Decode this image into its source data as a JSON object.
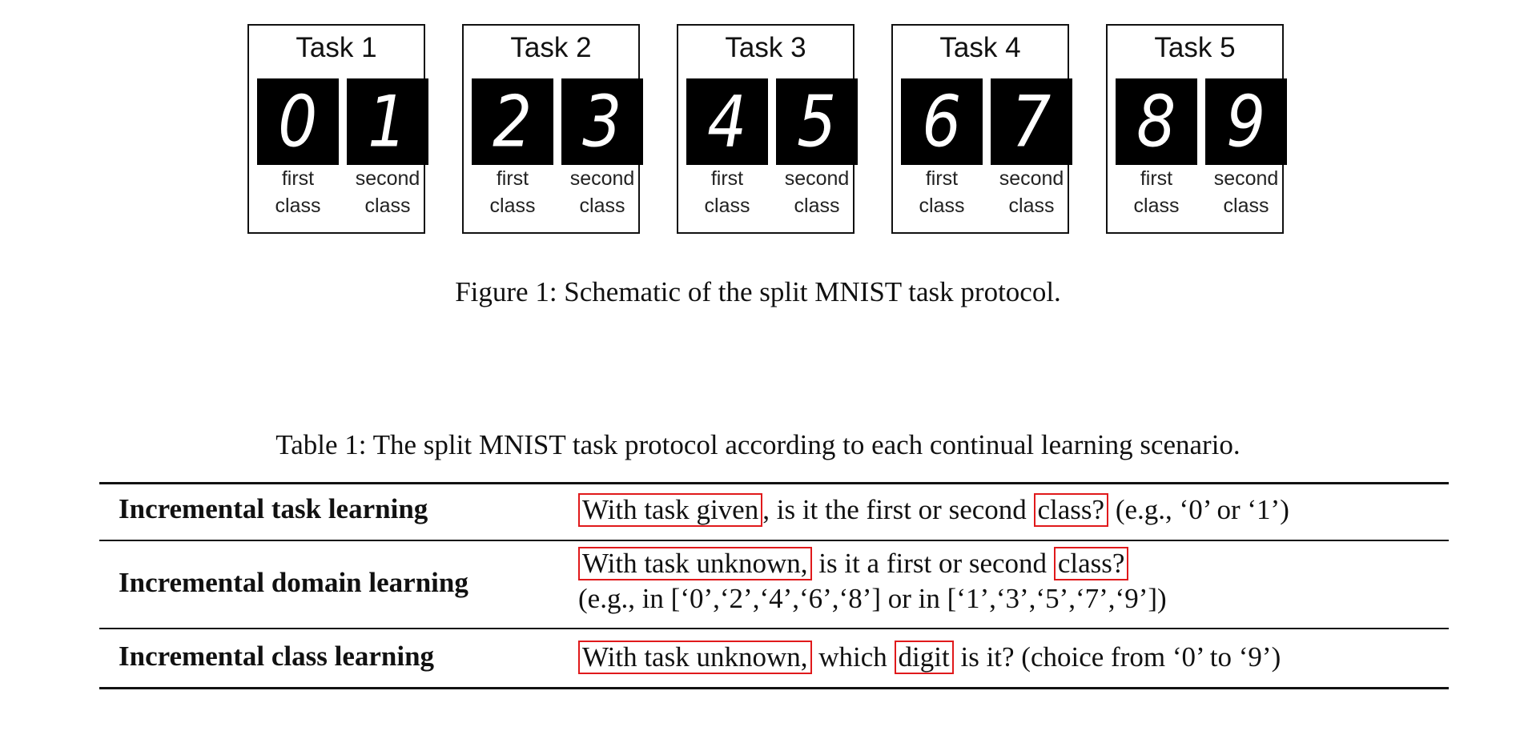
{
  "figure": {
    "tasks": [
      {
        "title": "Task 1",
        "first_digit": "0",
        "second_digit": "1",
        "first_label": "first\nclass",
        "second_label": "second\nclass"
      },
      {
        "title": "Task 2",
        "first_digit": "2",
        "second_digit": "3",
        "first_label": "first\nclass",
        "second_label": "second\nclass"
      },
      {
        "title": "Task 3",
        "first_digit": "4",
        "second_digit": "5",
        "first_label": "first\nclass",
        "second_label": "second\nclass"
      },
      {
        "title": "Task 4",
        "first_digit": "6",
        "second_digit": "7",
        "first_label": "first\nclass",
        "second_label": "second\nclass"
      },
      {
        "title": "Task 5",
        "first_digit": "8",
        "second_digit": "9",
        "first_label": "first\nclass",
        "second_label": "second\nclass"
      }
    ],
    "caption": "Figure 1: Schematic of the split MNIST task protocol."
  },
  "table": {
    "caption": "Table 1: The split MNIST task protocol according to each continual learning scenario.",
    "rows": [
      {
        "scenario": "Incremental task learning",
        "boxed1": "With task given",
        "text1": ", is it the first or second ",
        "boxed2": "class?",
        "text2": " (e.g., ‘0’ or ‘1’)"
      },
      {
        "scenario": "Incremental domain learning",
        "boxed1": "With task unknown,",
        "text1": " is it a first or second ",
        "boxed2": "class?",
        "text2": "",
        "line2": "(e.g., in [‘0’,‘2’,‘4’,‘6’,‘8’] or in [‘1’,‘3’,‘5’,‘7’,‘9’])"
      },
      {
        "scenario": "Incremental class learning",
        "boxed1": "With task unknown,",
        "text1": " which ",
        "boxed2": "digit",
        "text2": " is it? (choice from ‘0’ to ‘9’)"
      }
    ]
  },
  "colors": {
    "highlight_box": "#e0191b",
    "digit_background": "#000000",
    "text": "#111111"
  }
}
